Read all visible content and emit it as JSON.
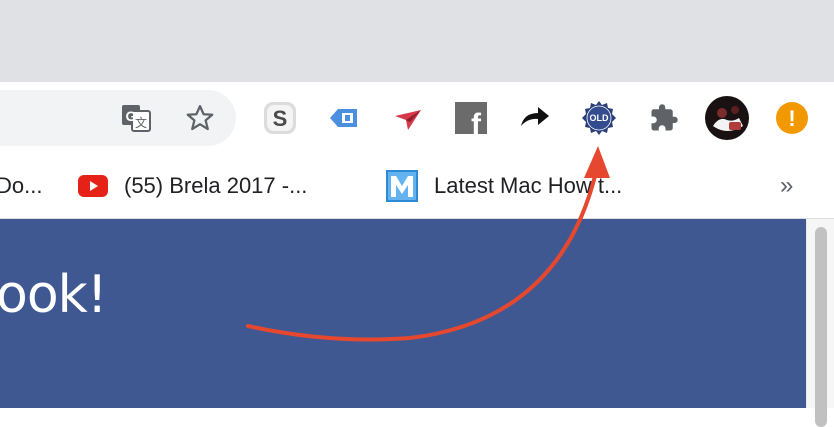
{
  "toolbar": {
    "extensions": [
      {
        "name": "google-translate-icon"
      },
      {
        "name": "bookmark-star-icon"
      },
      {
        "name": "s-extension-icon",
        "letter": "S"
      },
      {
        "name": "tag-extension-icon"
      },
      {
        "name": "paper-plane-extension-icon"
      },
      {
        "name": "facebook-extension-icon",
        "letter": "f"
      },
      {
        "name": "forward-arrow-extension-icon"
      },
      {
        "name": "old-badge-extension-icon",
        "badge_text": "OLD"
      },
      {
        "name": "puzzle-extensions-icon"
      },
      {
        "name": "profile-avatar"
      },
      {
        "name": "update-alert-icon",
        "symbol": "!"
      }
    ]
  },
  "bookmarks": {
    "items": [
      {
        "label": "Do..."
      },
      {
        "label": "(55) Brela 2017 -..."
      },
      {
        "label": "Latest Mac How t..."
      }
    ],
    "overflow": "»"
  },
  "content": {
    "headline": "ook!"
  },
  "colors": {
    "facebook_blue": "#3f5891",
    "annotation_red": "#e5482f",
    "alert_orange": "#f29900",
    "tab_strip": "#dfe1e5"
  }
}
